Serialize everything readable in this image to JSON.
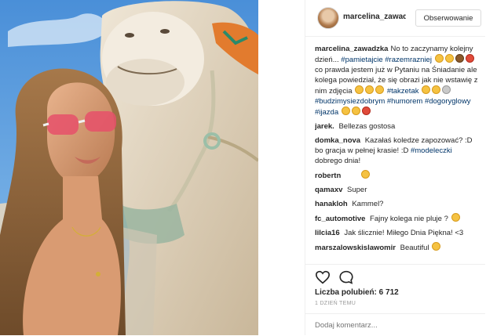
{
  "post": {
    "author": "marcelina_zawadzka",
    "follow_label": "Obserwowanie",
    "likes_label": "Liczba polubień: 6 712",
    "time_label": "1 DZIEŃ TEMU",
    "add_comment_placeholder": "Dodaj komentarz..."
  },
  "caption": {
    "user": "marcelina_zawadzka",
    "part1": "No to zaczynamy kolejny dzień...",
    "tag1": "#pamietajcie",
    "tag2": "#razemrazniej",
    "part2": "co prawda jestem już w Pytaniu na Śniadanie ale kolega powiedział, że się obrazi jak nie wstawię z nim zdjęcia",
    "tag3": "#takzetak",
    "tag4": "#budzimysiezdobrym",
    "tag5": "#humorem",
    "tag6": "#dogoryglowy",
    "tag7": "#ijazda"
  },
  "comments": [
    {
      "user": "jarek.",
      "text": "Bellezas gostosa"
    },
    {
      "user": "domka_nova",
      "text": "Kazałaś koledze zapozować? :D bo gracja w pełnej krasie! :D"
    },
    {
      "user": "robertn",
      "text": ""
    },
    {
      "user": "qamaxv",
      "text": "Super"
    },
    {
      "user": "hanakloh",
      "text": "Kammel?"
    },
    {
      "user": "fc_automotive",
      "text": "Fajny kolega nie pluje ?"
    },
    {
      "user": "lilcia16",
      "text": "Jak ślicznie! Miłego Dnia Piękna! <3"
    },
    {
      "user": "marszalowskislawomir",
      "text": "Beautiful"
    }
  ],
  "extra": {
    "domka_tag": "#modeleczki",
    "domka_tail": "dobrego dnia!"
  },
  "icons": {
    "like": "heart-icon",
    "comment": "comment-bubble-icon"
  }
}
